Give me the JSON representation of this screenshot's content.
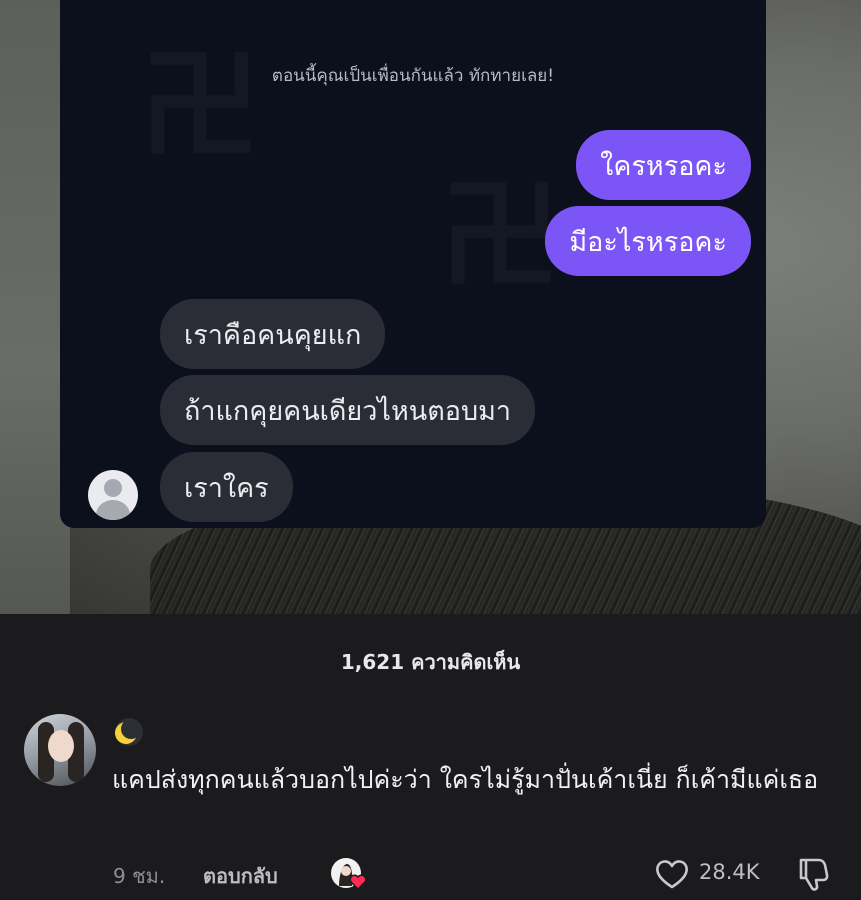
{
  "chat": {
    "system_message": "ตอนนี้คุณเป็นเพื่อนกันแล้ว ทักทายเลย!",
    "outgoing": [
      "ใครหรอคะ",
      "มีอะไรหรอคะ"
    ],
    "incoming": [
      "เราคือคนคุยแก",
      "ถ้าแกคุยคนเดียวไหนตอบมา",
      "เราใคร"
    ],
    "accent_color": "#7c55f7",
    "contact_avatar_icon": "default-user-icon"
  },
  "comments": {
    "count_label": "1,621 ความคิดเห็น",
    "items": [
      {
        "username_emoji": "crescent-moon-emoji",
        "text": "แคปส่งทุกคนแล้วบอกไปค่ะว่า ใครไม่รู้มาปั่นเค้าเนี่ย ก็เค้ามีแค่เธอ",
        "time": "9 ชม.",
        "reply_label": "ตอบกลับ",
        "likes": "28.4K",
        "creator_liked": true
      }
    ]
  }
}
